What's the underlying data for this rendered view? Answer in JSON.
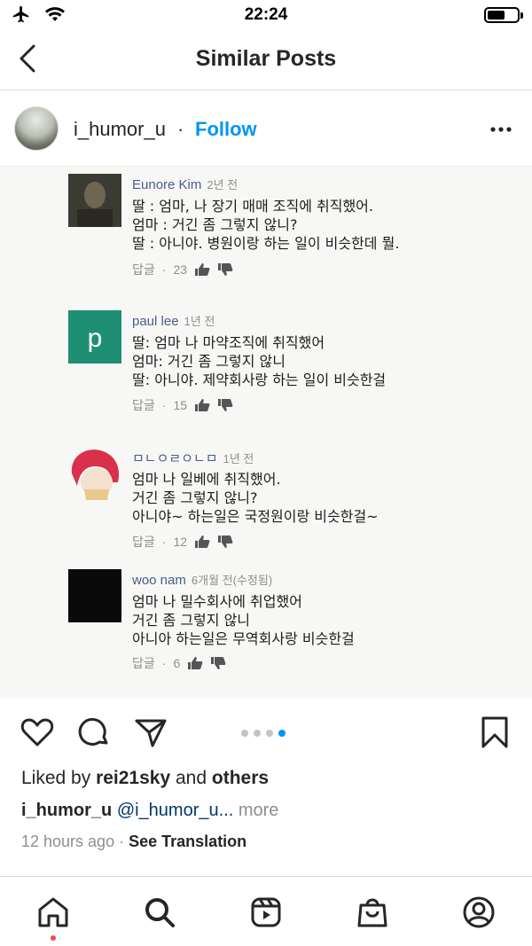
{
  "status_bar": {
    "time": "22:24",
    "battery_level": 0.6
  },
  "nav": {
    "title": "Similar Posts"
  },
  "post": {
    "username": "i_humor_u",
    "separator": "·",
    "follow_label": "Follow"
  },
  "comments": [
    {
      "name": "Eunore Kim",
      "time": "2년 전",
      "lines": [
        "딸 : 엄마, 나 장기 매매 조직에 취직했어.",
        "엄마 : 거긴 좀 그렇지 않니?",
        "딸 : 아니야. 병원이랑 하는 일이 비슷한데 뭘."
      ],
      "reply_label": "답글",
      "likes": "23",
      "avatar_letter": ""
    },
    {
      "name": "paul lee",
      "time": "1년 전",
      "lines": [
        "딸: 엄마 나 마약조직에 취직했어",
        "엄마: 거긴 좀 그렇지 않니",
        "딸: 아니야. 제약회사랑 하는 일이 비슷한걸"
      ],
      "reply_label": "답글",
      "likes": "15",
      "avatar_letter": "p"
    },
    {
      "name": "ㅁㄴㅇㄹㅇㄴㅁ",
      "time": "1년 전",
      "lines": [
        "엄마 나 일베에 취직했어.",
        "거긴 좀 그렇지 않니?",
        "아니야~ 하는일은 국정원이랑 비슷한걸~"
      ],
      "reply_label": "답글",
      "likes": "12",
      "avatar_letter": ""
    },
    {
      "name": "woo nam",
      "time": "6개월 전(수정됨)",
      "lines": [
        "엄마 나 밀수회사에 취업했어",
        "거긴 좀 그렇지 않니",
        "아니아 하는일은 무역회사랑 비슷한걸"
      ],
      "reply_label": "답글",
      "likes": "6",
      "avatar_letter": ""
    }
  ],
  "carousel": {
    "count": 4,
    "active_index": 3
  },
  "likes": {
    "prefix": "Liked by",
    "user": "rei21sky",
    "conj": "and",
    "others": "others"
  },
  "caption": {
    "user": "i_humor_u",
    "mention": "@i_humor_u...",
    "more": "more"
  },
  "meta": {
    "time": "12 hours ago",
    "separator": "·",
    "see_translation": "See Translation"
  },
  "colors": {
    "accent": "#0095f6",
    "text": "#262626",
    "secondary": "#8e8e8e",
    "paul_avatar": "#1e8f73"
  }
}
